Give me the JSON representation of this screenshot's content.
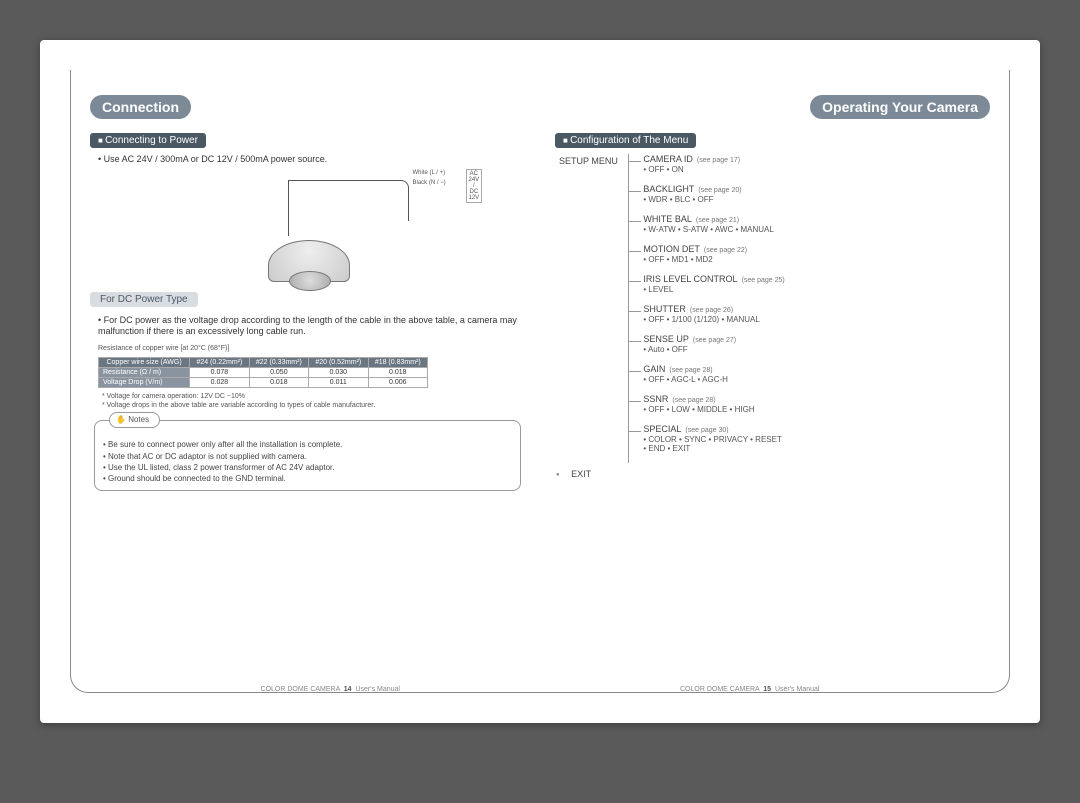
{
  "left": {
    "title": "Connection",
    "section1": "Connecting to Power",
    "power_spec": "• Use AC 24V / 300mA or DC 12V / 500mA power source.",
    "wire_white": "White (L / +)",
    "wire_black": "Black (N / −)",
    "wire_box": "AC 24V / DC 12V",
    "subheader": "For DC Power Type",
    "dc_text": "• For DC power as the voltage drop according to the length of the cable in the above table, a camera may malfunction if there is an excessively long cable run.",
    "table_caption": "Resistance of copper wire [at 20°C (68°F)]",
    "table": {
      "headers": [
        "Copper wire size (AWG)",
        "#24 (0.22mm²)",
        "#22 (0.33mm²)",
        "#20 (0.52mm²)",
        "#18 (0.83mm²)"
      ],
      "rows": [
        {
          "label": "Resistance (Ω / m)",
          "cells": [
            "0.078",
            "0.050",
            "0.030",
            "0.018"
          ]
        },
        {
          "label": "Voltage Drop (V/m)",
          "cells": [
            "0.028",
            "0.018",
            "0.011",
            "0.006"
          ]
        }
      ]
    },
    "small_notes": [
      "* Voltage for camera operation: 12V DC −10%",
      "* Voltage drops in the above table are variable according to types of cable manufacturer."
    ],
    "notes_label": "Notes",
    "notes_items": [
      "• Be sure to connect power only after all the installation is complete.",
      "• Note that AC or DC adaptor is not supplied with camera.",
      "• Use the UL listed, class 2 power transformer of AC 24V adaptor.",
      "• Ground should be connected to the GND terminal."
    ],
    "footer_product": "COLOR DOME CAMERA",
    "footer_page": "14",
    "footer_label": "User's Manual"
  },
  "right": {
    "title": "Operating Your Camera",
    "section1": "Configuration of The Menu",
    "root": "SETUP MENU",
    "exit": "EXIT",
    "items": [
      {
        "title": "CAMERA ID",
        "page": "(see page 17)",
        "sub": "• OFF   • ON"
      },
      {
        "title": "BACKLIGHT",
        "page": "(see page 20)",
        "sub": "• WDR   • BLC   • OFF"
      },
      {
        "title": "WHITE BAL",
        "page": "(see page 21)",
        "sub": "• W-ATW   • S-ATW   • AWC   • MANUAL"
      },
      {
        "title": "MOTION DET",
        "page": "(see page 22)",
        "sub": "• OFF   • MD1   • MD2"
      },
      {
        "title": "IRIS LEVEL CONTROL",
        "page": "(see page 25)",
        "sub": "• LEVEL"
      },
      {
        "title": "SHUTTER",
        "page": "(see page 26)",
        "sub": "• OFF   • 1/100 (1/120)   • MANUAL"
      },
      {
        "title": "SENSE UP",
        "page": "(see page 27)",
        "sub": "• Auto   • OFF"
      },
      {
        "title": "GAIN",
        "page": "(see page 28)",
        "sub": "• OFF   • AGC-L   • AGC-H"
      },
      {
        "title": "SSNR",
        "page": "(see page 28)",
        "sub": "• OFF   • LOW   • MIDDLE   • HIGH"
      },
      {
        "title": "SPECIAL",
        "page": "(see page 30)",
        "sub": "• COLOR   • SYNC   • PRIVACY   • RESET\n• END        • EXIT"
      }
    ],
    "footer_product": "COLOR DOME CAMERA",
    "footer_page": "15",
    "footer_label": "User's Manual"
  }
}
